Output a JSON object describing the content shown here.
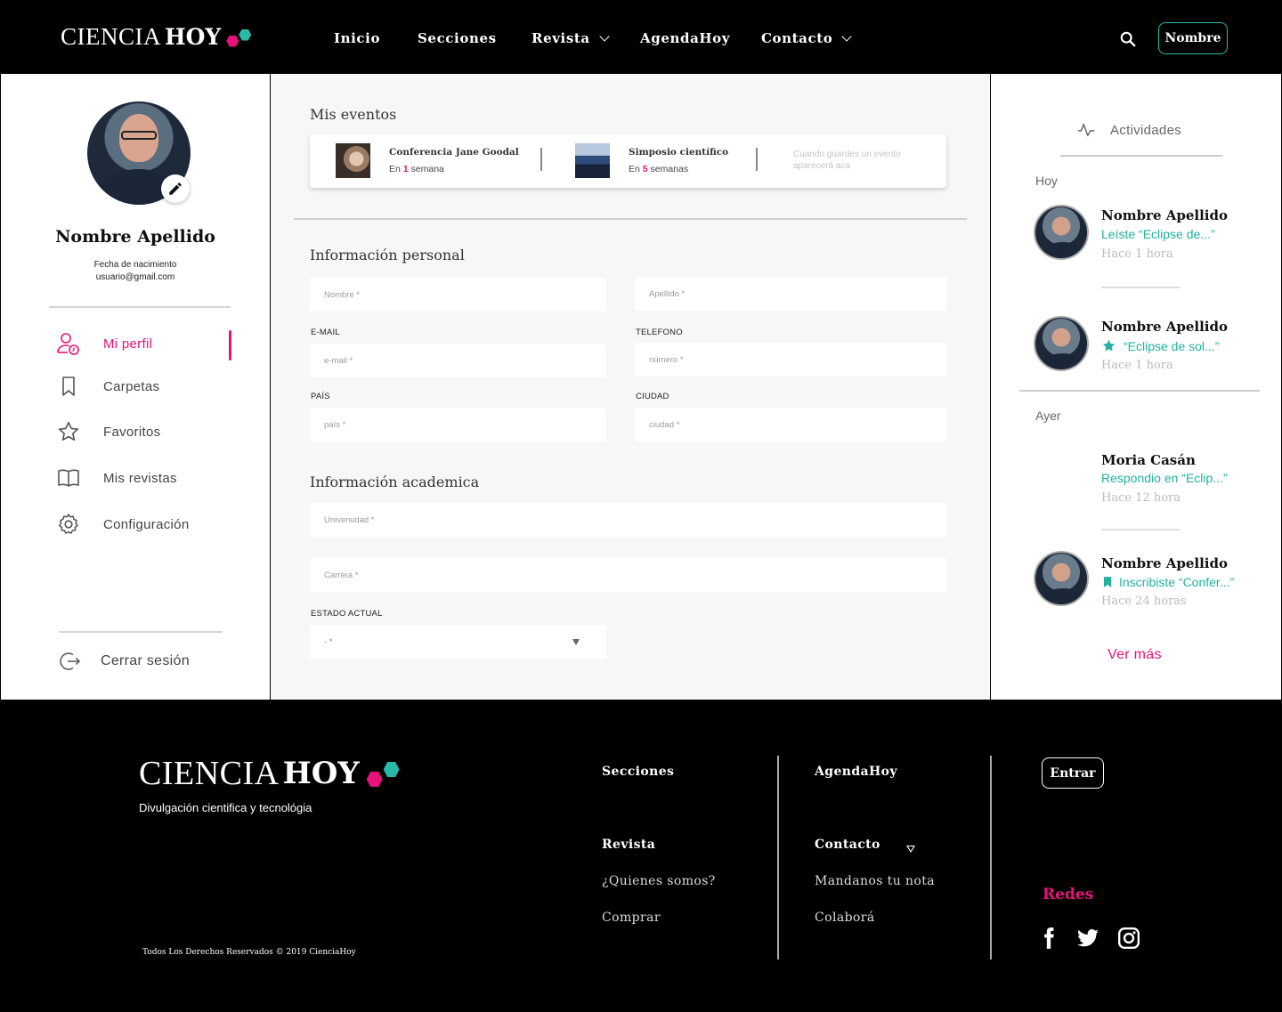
{
  "brand": {
    "part1": "CIENCIA",
    "part2": "HOY",
    "colors": {
      "pink": "#e6127a",
      "teal": "#2ab8a8"
    }
  },
  "nav": {
    "items": [
      {
        "label": "Inicio"
      },
      {
        "label": "Secciones"
      },
      {
        "label": "Revista"
      },
      {
        "label": "AgendaHoy"
      },
      {
        "label": "Contacto"
      }
    ],
    "search_icon": "search-icon",
    "user_button": "Nombre"
  },
  "profile": {
    "name": "Nombre Apellido",
    "birth_label": "Fecha de nacimiento",
    "email": "usuario@gmail.com",
    "menu": [
      {
        "label": "Mi perfil",
        "icon": "user-clock-icon"
      },
      {
        "label": "Carpetas",
        "icon": "bookmark-icon"
      },
      {
        "label": "Favoritos",
        "icon": "star-icon"
      },
      {
        "label": "Mis revistas",
        "icon": "book-icon"
      },
      {
        "label": "Configuración",
        "icon": "gear-icon"
      }
    ],
    "logout": "Cerrar sesión"
  },
  "events": {
    "title": "Mis eventos",
    "items": [
      {
        "title": "Conferencia Jane Goodal",
        "pre": "En ",
        "num": "1",
        "post": " semana"
      },
      {
        "title": "Simposio científico",
        "pre": "En ",
        "num": "5",
        "post": " semanas"
      }
    ],
    "empty_text": "Cuando guardes un evento aparecerá aca"
  },
  "personal": {
    "title": "Información personal",
    "nombre_placeholder": "Nombre *",
    "apellido_placeholder": "Apellido *",
    "email_label": "E-MAIL",
    "email_placeholder": "e-mail *",
    "telefono_label": "TELEFONO",
    "telefono_placeholder": "número *",
    "pais_label": "PAÍS",
    "pais_placeholder": "país *",
    "ciudad_label": "CIUDAD",
    "ciudad_placeholder": "ciudad *"
  },
  "academic": {
    "title": "Información academica",
    "universidad_placeholder": "Universidad *",
    "carrera_placeholder": "Carrera *",
    "estado_label": "ESTADO ACTUAL",
    "estado_value": "- *"
  },
  "activities": {
    "title": "Actividades",
    "today_label": "Hoy",
    "yesterday_label": "Ayer",
    "items": [
      {
        "name": "Nombre Apellido",
        "desc": "Leíste “Eclipse de...”",
        "time": "Hace 1 hora"
      },
      {
        "name": "Nombre Apellido",
        "desc": "“Eclipse de sol...”",
        "time": "Hace 1 hora"
      },
      {
        "name": "Moria Casán",
        "desc": "Respondio en “Eclip...”",
        "time": "Hace 12 hora"
      },
      {
        "name": "Nombre Apellido",
        "desc": "Inscribiste “Confer...”",
        "time": "Hace 24 horas"
      }
    ],
    "more": "Ver más"
  },
  "footer": {
    "tagline": "Divulgación cientifica y tecnológia",
    "copyright": "Todos Los Derechos Reservados © 2019 CienciaHoy",
    "col1": {
      "head1": "Secciones",
      "head2": "Revista",
      "link1": "¿Quienes somos?",
      "link2": "Comprar"
    },
    "col2": {
      "head1": "AgendaHoy",
      "head2": "Contacto",
      "link1": "Mandanos tu nota",
      "link2": "Colaborá"
    },
    "login_button": "Entrar",
    "social_title": "Redes",
    "social": [
      "facebook-icon",
      "twitter-icon",
      "instagram-icon"
    ]
  }
}
